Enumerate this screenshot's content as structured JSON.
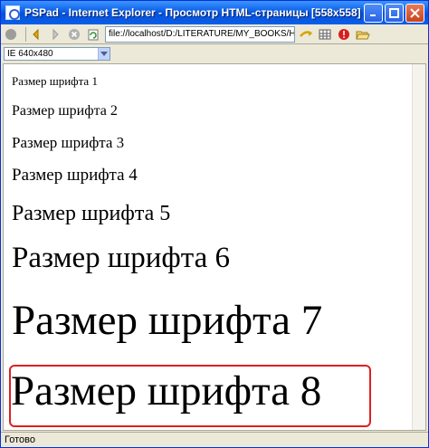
{
  "window": {
    "title": "PSPad - Internet Explorer - Просмотр HTML-страницы    [558x558]"
  },
  "toolbar": {
    "address": "file://localhost/D:/LITERATURE/MY_BOOKS/HT"
  },
  "size_select": {
    "value": "IE 640x480"
  },
  "content": {
    "lines": [
      "Размер шрифта 1",
      "Размер шрифта 2",
      "Размер шрифта 3",
      "Размер шрифта 4",
      "Размер шрифта 5",
      "Размер шрифта 6",
      "Размер шрифта 7",
      "Размер шрифта 8"
    ]
  },
  "status": {
    "text": "Готово"
  },
  "colors": {
    "titlebar": "#0a5fe8",
    "highlight_border": "#e02020",
    "chrome": "#ece9d8"
  }
}
